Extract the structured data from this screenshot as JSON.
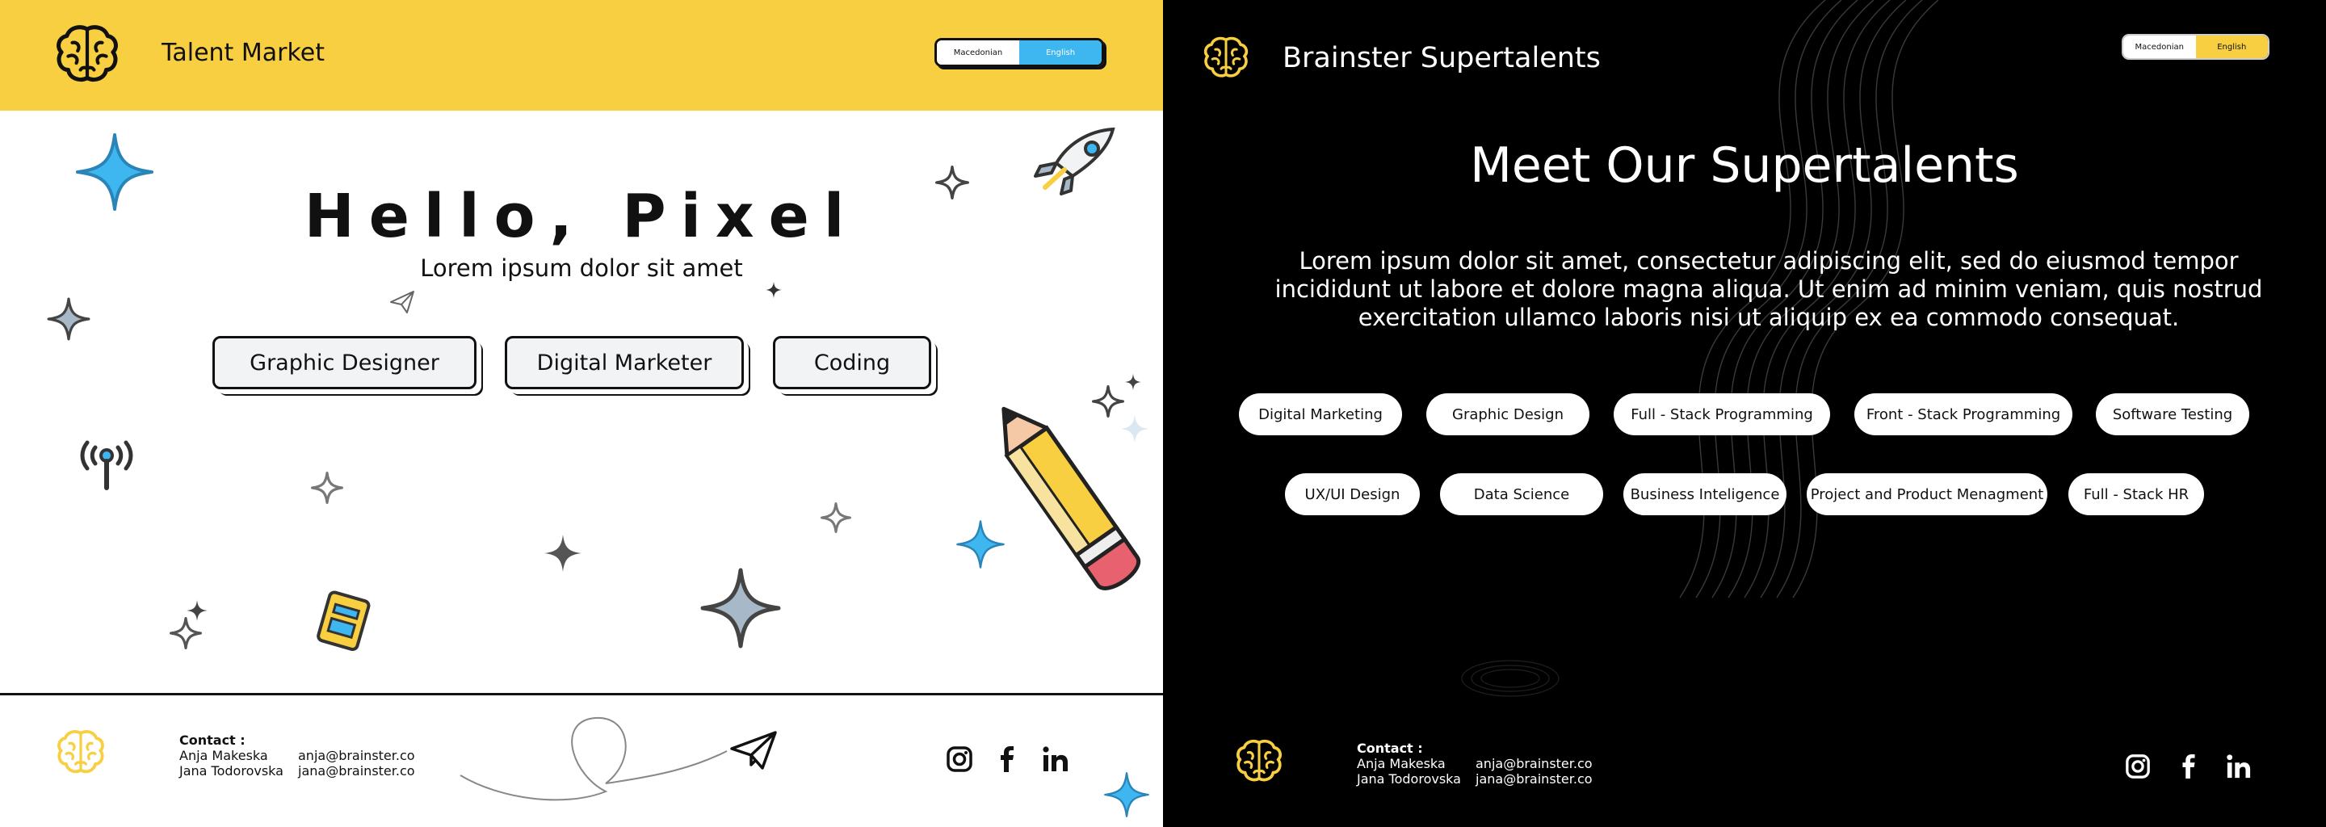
{
  "left": {
    "app_title": "Talent Market",
    "lang": {
      "mk": "Macedonian",
      "en": "English"
    },
    "hero": {
      "title": "Hello, Pixel",
      "subtitle": "Lorem ipsum dolor sit amet"
    },
    "categories": [
      "Graphic Designer",
      "Digital Marketer",
      "Coding"
    ],
    "footer": {
      "contact_label": "Contact :",
      "contacts": [
        {
          "name": "Anja Makeska",
          "email": "anja@brainster.co"
        },
        {
          "name": "Jana Todorovska",
          "email": "jana@brainster.co"
        }
      ]
    },
    "colors": {
      "header": "#f9cf42",
      "active_lang": "#3eb7f0"
    }
  },
  "right": {
    "app_title": "Brainster Supertalents",
    "lang": {
      "mk": "Macedonian",
      "en": "English"
    },
    "heading": "Meet Our Supertalents",
    "intro": "Lorem ipsum dolor sit amet, consectetur adipiscing elit, sed do eiusmod tempor incididunt ut labore et dolore magna aliqua. Ut enim ad minim veniam, quis nostrud exercitation ullamco laboris nisi ut aliquip ex ea commodo consequat.",
    "pills_row1": [
      "Digital Marketing",
      "Graphic Design",
      "Full - Stack Programming",
      "Front - Stack Programming",
      "Software Testing"
    ],
    "pills_row2": [
      "UX/UI Design",
      "Data Science",
      "Business Inteligence",
      "Project and Product Menagment",
      "Full - Stack HR"
    ],
    "footer": {
      "contact_label": "Contact :",
      "contacts": [
        {
          "name": "Anja Makeska",
          "email": "anja@brainster.co"
        },
        {
          "name": "Jana Todorovska",
          "email": "jana@brainster.co"
        }
      ]
    },
    "colors": {
      "background": "#000000",
      "active_lang": "#f9cf42"
    }
  },
  "icons": {
    "brain": "brain-icon",
    "instagram": "instagram-icon",
    "facebook": "facebook-icon",
    "linkedin": "linkedin-icon"
  }
}
